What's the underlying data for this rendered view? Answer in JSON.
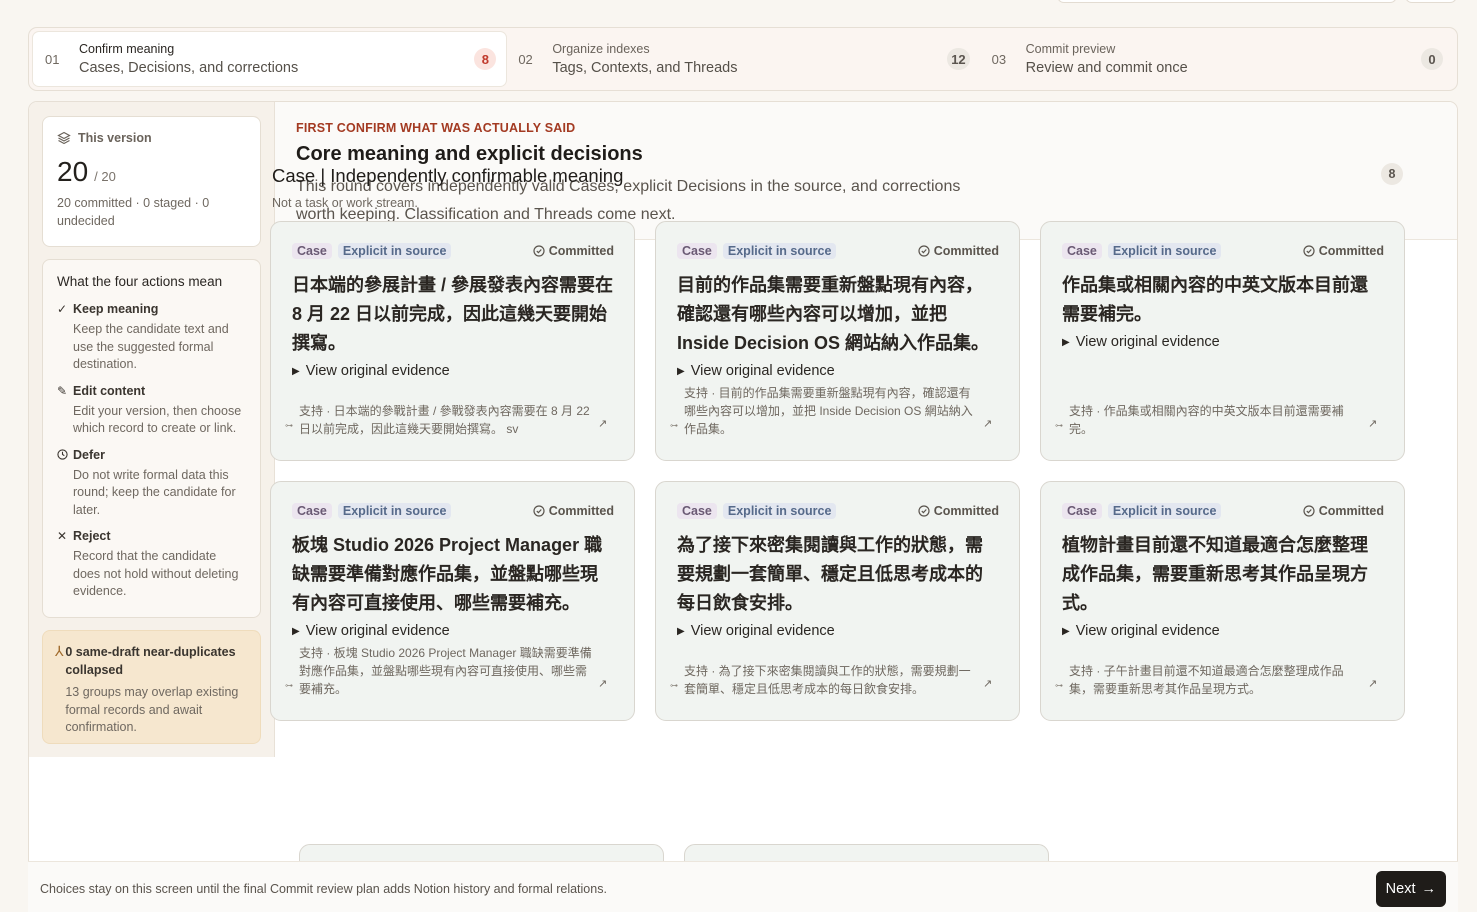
{
  "steps": [
    {
      "num": "01",
      "title": "Confirm meaning",
      "sub": "Cases, Decisions, and corrections",
      "count": "8"
    },
    {
      "num": "02",
      "title": "Organize indexes",
      "sub": "Tags, Contexts, and Threads",
      "count": "12"
    },
    {
      "num": "03",
      "title": "Commit preview",
      "sub": "Review and commit once",
      "count": "0"
    }
  ],
  "version": {
    "label": "This version",
    "current": "20",
    "total": "/ 20",
    "stats": "20 committed · 0 staged · 0 undecided"
  },
  "actions": {
    "title": "What the four actions mean",
    "items": [
      {
        "icon": "check-icon",
        "label": "Keep meaning",
        "desc": "Keep the candidate text and use the suggested formal destination."
      },
      {
        "icon": "pencil-icon",
        "label": "Edit content",
        "desc": "Edit your version, then choose which record to create or link."
      },
      {
        "icon": "clock-icon",
        "label": "Defer",
        "desc": "Do not write formal data this round; keep the candidate for later."
      },
      {
        "icon": "x-icon",
        "label": "Reject",
        "desc": "Record that the candidate does not hold without deleting evidence."
      }
    ]
  },
  "duplicates": {
    "title": "0 same-draft near-duplicates collapsed",
    "desc": "13 groups may overlap existing formal records and await confirmation."
  },
  "header": {
    "eyebrow": "FIRST CONFIRM WHAT WAS ACTUALLY SAID",
    "title": "Core meaning and explicit decisions",
    "desc": "This round covers independently valid Cases, explicit Decisions in the source, and corrections worth keeping. Classification and Threads come next."
  },
  "section": {
    "title": "Case | Independently confirmable meaning",
    "sub": "Not a task or work stream.",
    "count": "8"
  },
  "cards": [
    {
      "tag_type": "Case",
      "tag_source": "Explicit in source",
      "status": "Committed",
      "text": "日本端的參展計畫 / 參展發表內容需要在 8 月 22 日以前完成，因此這幾天要開始撰寫。",
      "evidence": "View original evidence",
      "quote": "支持 · 日本端的參戰計畫 / 參戰發表內容需要在 8 月 22 日以前完成，因此這幾天要開始撰寫。 sv"
    },
    {
      "tag_type": "Case",
      "tag_source": "Explicit in source",
      "status": "Committed",
      "text": "目前的作品集需要重新盤點現有內容，確認還有哪些內容可以增加，並把 Inside Decision OS 網站納入作品集。",
      "evidence": "View original evidence",
      "quote": "支持 · 目前的作品集需要重新盤點現有內容，確認還有哪些內容可以增加，並把 Inside Decision OS 網站納入作品集。"
    },
    {
      "tag_type": "Case",
      "tag_source": "Explicit in source",
      "status": "Committed",
      "text": "作品集或相關內容的中英文版本目前還需要補完。",
      "evidence": "View original evidence",
      "quote": "支持 · 作品集或相關內容的中英文版本目前還需要補完。"
    },
    {
      "tag_type": "Case",
      "tag_source": "Explicit in source",
      "status": "Committed",
      "text": "板塊 Studio 2026 Project Manager 職缺需要準備對應作品集，並盤點哪些現有內容可直接使用、哪些需要補充。",
      "evidence": "View original evidence",
      "quote": "支持 · 板塊 Studio 2026 Project Manager 職缺需要準備對應作品集，並盤點哪些現有內容可直接使用、哪些需要補充。"
    },
    {
      "tag_type": "Case",
      "tag_source": "Explicit in source",
      "status": "Committed",
      "text": "為了接下來密集閱讀與工作的狀態，需要規劃一套簡單、穩定且低思考成本的每日飲食安排。",
      "evidence": "View original evidence",
      "quote": "支持 · 為了接下來密集閱讀與工作的狀態，需要規劃一套簡單、穩定且低思考成本的每日飲食安排。"
    },
    {
      "tag_type": "Case",
      "tag_source": "Explicit in source",
      "status": "Committed",
      "text": "植物計畫目前還不知道最適合怎麼整理成作品集，需要重新思考其作品呈現方式。",
      "evidence": "View original evidence",
      "quote": "支持 · 子午計畫目前還不知道最適合怎麼整理成作品集，需要重新思考其作品呈現方式。"
    }
  ],
  "footer": {
    "note": "Choices stay on this screen until the final Commit review plan adds Notion history and formal relations.",
    "next": "Next"
  }
}
